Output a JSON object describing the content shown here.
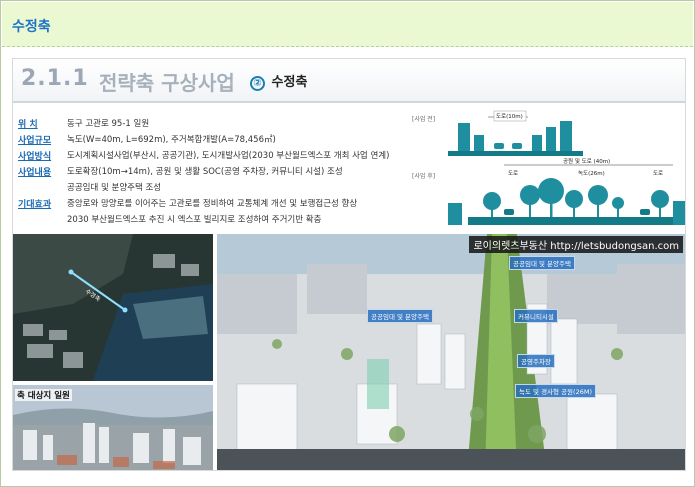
{
  "header": {
    "title": "수정축"
  },
  "slide": {
    "section_number": "2.1.1",
    "section_title": "전략축 구상사업",
    "badge_number": "②",
    "badge_label": "수정축",
    "info": [
      {
        "label": "위   치",
        "value": "동구 고관로 95-1 일원"
      },
      {
        "label": "사업규모",
        "value": "녹도(W=40m, L=692m), 주거복합개발(A=78,456㎡)"
      },
      {
        "label": "사업방식",
        "value": "도시계획시설사업(부산시, 공공기관), 도시개발사업(2030 부산월드엑스포 개최 사업 연계)"
      },
      {
        "label": "사업내용",
        "value": "도로확장(10m→14m), 공원 및 생활 SOC(공영 주차장, 커뮤니티 시설) 조성"
      },
      {
        "label": "",
        "value": "공공임대 및 분양주택 조성"
      },
      {
        "label": "기대효과",
        "value": "중앙로와 망양로를 이어주는 고관로를 정비하여 교통체계 개선 및 보행접근성 향상"
      },
      {
        "label": "",
        "value": "2030 부산월드엑스포 추진 시 엑스포 빌리지로 조성하여 주거기반 확충"
      }
    ],
    "diagram": {
      "before_label": "[사업 전]",
      "after_label": "[사업 후]",
      "road_before": "도로(10m)",
      "park_road": "공원 및 도로 (40m)",
      "road_left": "도로",
      "green_road": "녹도(26m)",
      "road_right": "도로"
    },
    "map_labels": [
      "수정축"
    ],
    "city_photo_label": "축 대상지 일원",
    "rendering": {
      "watermark": "로이의렛츠부동산 http://letsbudongsan.com",
      "tags": [
        "공공임대 및 분양주택",
        "공공임대 및 분양주택",
        "커뮤니티시설",
        "공영주차장",
        "녹도 및 경사형 공원(26M)"
      ]
    }
  }
}
